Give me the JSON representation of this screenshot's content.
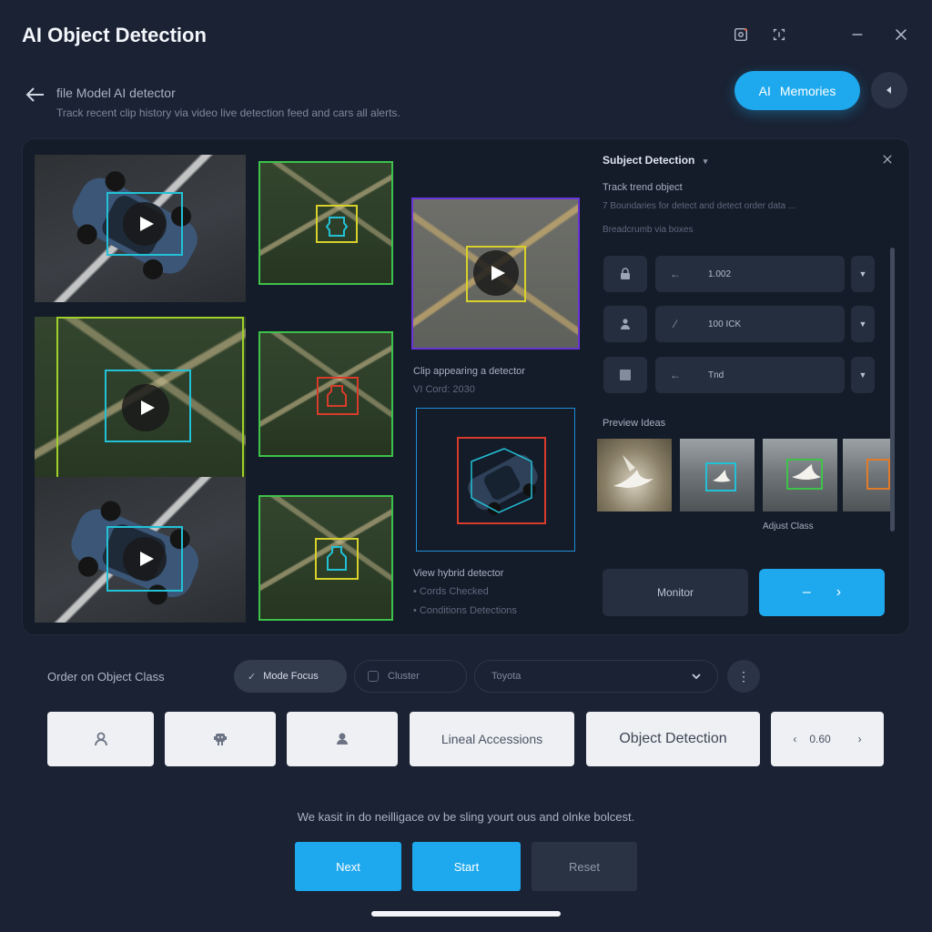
{
  "window": {
    "title": "AI Object Detection"
  },
  "header": {
    "breadcrumb": "file Model AI detector",
    "subtitle": "Track recent clip history via video live detection feed and cars all alerts.",
    "cta_label": "Memories",
    "cta_prefix": "AI"
  },
  "gallery": {
    "caption_1_title": "Clip appearing a detector",
    "caption_1_meta": "VI Cord: 2030",
    "caption_2_title": "View hybrid detector",
    "caption_2_line_1": "Cords Checked",
    "caption_2_line_2": "Conditions Detections"
  },
  "side_panel": {
    "title": "Subject Detection",
    "track_label": "Track trend object",
    "track_desc": "7 Boundaries for detect and detect order data ...",
    "section_dim": "Breadcrumb via boxes",
    "fields": [
      {
        "icon": "lock-icon",
        "glyph": "←",
        "value": "1.002"
      },
      {
        "icon": "person-icon",
        "glyph": "⁄",
        "value": "100 ICK"
      },
      {
        "icon": "grid-icon",
        "glyph": "←",
        "value": "Tnd"
      }
    ],
    "preview_label": "Preview Ideas",
    "preview_caption": "Adjust Class",
    "secondary_button": "Monitor",
    "primary_button_left": "–",
    "primary_button_right": "›"
  },
  "filters": {
    "label": "Order on Object Class",
    "chip_1": "Mode Focus",
    "chip_2": "Cluster",
    "dropdown_value": "Toyota",
    "more_label": "⋮"
  },
  "class_buttons": {
    "b4": "Lineal Accessions",
    "b5": "Object Detection",
    "b6_value": "0.60"
  },
  "footer": {
    "helper_text": "We kasit in do neilligace ov be sling yourt ous and olnke bolcest.",
    "btn_next": "Next",
    "btn_start": "Start",
    "btn_reset": "Reset"
  },
  "colors": {
    "accent": "#1ea9ee",
    "background": "#1a2233",
    "panel": "#141b29",
    "box_cyan": "#22c1d6",
    "box_yellow": "#d7d12a",
    "box_green": "#3ec24a",
    "box_red": "#d73b2a",
    "box_purple": "#6a35d6",
    "box_blue": "#1f8fd6",
    "box_orange": "#e07b2a"
  }
}
